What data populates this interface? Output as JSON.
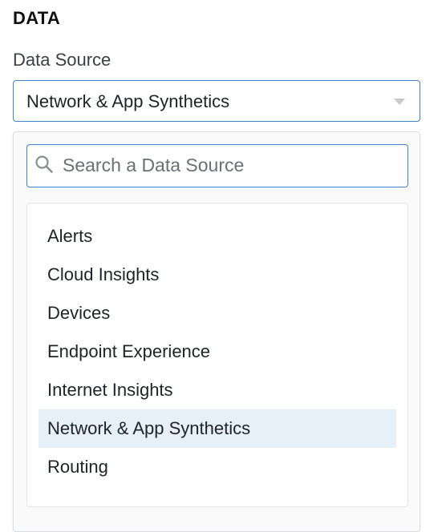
{
  "section": {
    "title": "DATA"
  },
  "data_source": {
    "label": "Data Source",
    "selected_value": "Network & App Synthetics"
  },
  "dropdown": {
    "search_placeholder": "Search a Data Source",
    "search_value": "",
    "options": [
      {
        "label": "Alerts",
        "selected": false
      },
      {
        "label": "Cloud Insights",
        "selected": false
      },
      {
        "label": "Devices",
        "selected": false
      },
      {
        "label": "Endpoint Experience",
        "selected": false
      },
      {
        "label": "Internet Insights",
        "selected": false
      },
      {
        "label": "Network & App Synthetics",
        "selected": true
      },
      {
        "label": "Routing",
        "selected": false
      }
    ]
  },
  "colors": {
    "focus_border": "#3f84c9",
    "selected_option_bg": "#e6f0f9",
    "caret": "#c7cbd0"
  },
  "icons": {
    "search": "search-icon",
    "caret": "chevron-down-icon"
  }
}
